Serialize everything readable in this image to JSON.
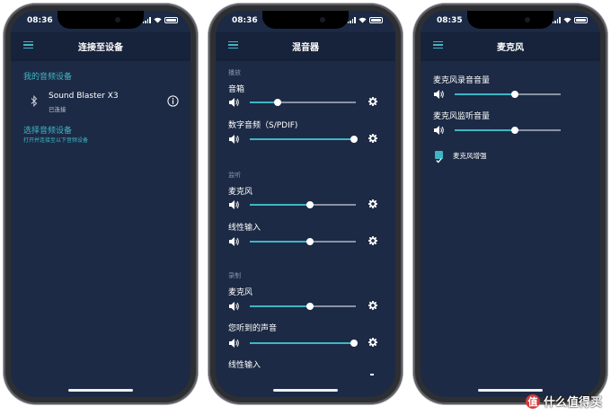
{
  "screens": [
    {
      "time": "08:36",
      "title": "连接至设备",
      "my_devices_label": "我的音频设备",
      "device_name": "Sound Blaster X3",
      "device_status": "已连接",
      "select_label": "选择音频设备",
      "select_hint": "打开并连接至以下音频设备"
    },
    {
      "time": "08:36",
      "title": "混音器",
      "playback_section": "播放",
      "speaker_label": "音箱",
      "speaker_level": 0.26,
      "digital_label": "数字音频（S/PDIF)",
      "digital_level": 0.98,
      "monitor_section": "监听",
      "mic_monitor_label": "麦克风",
      "mic_monitor_level": 0.57,
      "line_in_monitor_label": "线性输入",
      "line_in_monitor_level": 0.57,
      "record_section": "录制",
      "mic_record_label": "麦克风",
      "mic_record_level": 0.57,
      "what_u_hear_label": "您听到的声音",
      "what_u_hear_level": 0.98,
      "line_in_record_label": "线性输入"
    },
    {
      "time": "08:35",
      "title": "麦克风",
      "mic_rec_volume_label": "麦克风录音音量",
      "mic_rec_volume_level": 0.57,
      "mic_mon_volume_label": "麦克风监听音量",
      "mic_mon_volume_level": 0.57,
      "mic_boost_label": "麦克风增强",
      "mic_boost_checked": true
    }
  ],
  "watermark": {
    "logo_char": "值",
    "text": "什么值得买"
  },
  "colors": {
    "screen_bg": "#1c2a45",
    "header_bg": "#17233b",
    "accent": "#3fb6c4"
  }
}
